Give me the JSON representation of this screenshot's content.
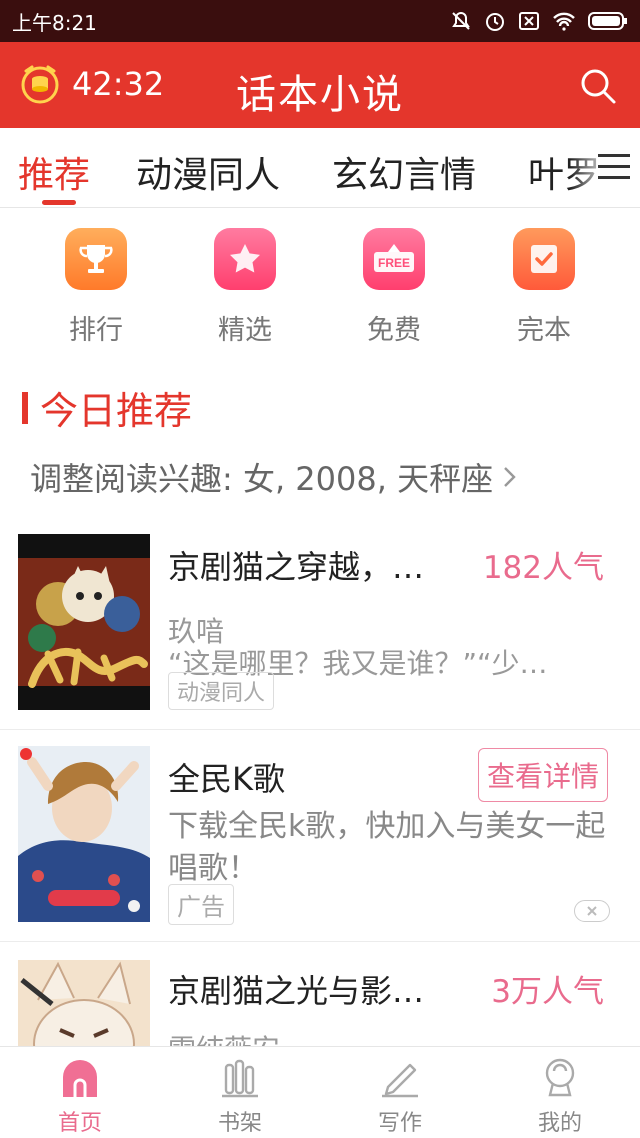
{
  "status_bar": {
    "time": "上午8:21"
  },
  "header": {
    "timer": "42:32",
    "title": "话本小说"
  },
  "tabs": [
    {
      "label": "推荐",
      "active": true
    },
    {
      "label": "动漫同人",
      "active": false
    },
    {
      "label": "玄幻言情",
      "active": false
    },
    {
      "label": "叶罗",
      "active": false
    }
  ],
  "entries": [
    {
      "label": "排行",
      "icon": "trophy-icon",
      "color": "#ff8a3d"
    },
    {
      "label": "精选",
      "icon": "star-icon",
      "color": "#ff4f7a"
    },
    {
      "label": "免费",
      "icon": "free-tag-icon",
      "color": "#ff4f7a"
    },
    {
      "label": "完本",
      "icon": "check-book-icon",
      "color": "#ff6a3d"
    }
  ],
  "section": {
    "title": "今日推荐",
    "interest": "调整阅读兴趣: 女, 2008, 天秤座"
  },
  "items": [
    {
      "title": "京剧猫之穿越，…",
      "popularity": "182人气",
      "author": "玖喑",
      "desc": "“这是哪里？我又是谁？”“少…",
      "tag": "动漫同人"
    },
    {
      "title": "全民K歌",
      "button": "查看详情",
      "desc": "下载全民k歌，快加入与美女一起唱歌！",
      "tag": "广告"
    },
    {
      "title": "京剧猫之光与影…",
      "popularity": "3万人气",
      "author": "雪纯薇安"
    }
  ],
  "bottom_nav": [
    {
      "label": "首页",
      "active": true
    },
    {
      "label": "书架",
      "active": false
    },
    {
      "label": "写作",
      "active": false
    },
    {
      "label": "我的",
      "active": false
    }
  ],
  "colors": {
    "brand": "#e4362c",
    "accent_pink": "#e96b8d"
  }
}
